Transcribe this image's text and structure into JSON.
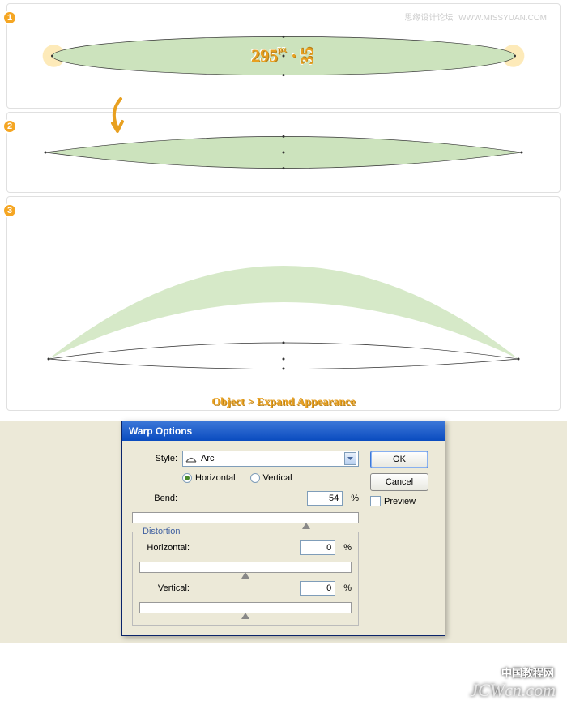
{
  "header": {
    "forum": "思缘设计论坛",
    "url": "WWW.MISSYUAN.COM"
  },
  "steps": {
    "one": {
      "badge": "1",
      "width_px": "295",
      "px_unit": "px",
      "height_px": "35"
    },
    "two": {
      "badge": "2"
    },
    "three": {
      "badge": "3",
      "expand_label": "Object > Expand Appearance"
    }
  },
  "dialog": {
    "title": "Warp Options",
    "style_label": "Style:",
    "style_value": "Arc",
    "orientation": {
      "horizontal": "Horizontal",
      "vertical": "Vertical"
    },
    "bend_label": "Bend:",
    "bend_value": "54",
    "distortion": {
      "legend": "Distortion",
      "horizontal_label": "Horizontal:",
      "horizontal_value": "0",
      "vertical_label": "Vertical:",
      "vertical_value": "0"
    },
    "percent": "%",
    "buttons": {
      "ok": "OK",
      "cancel": "Cancel"
    },
    "preview": "Preview"
  },
  "watermark": {
    "cn": "中国教程网",
    "en": "JCWcn.com"
  }
}
